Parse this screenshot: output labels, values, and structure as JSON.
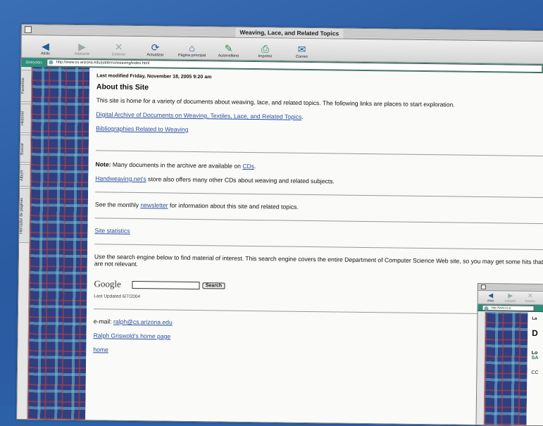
{
  "window": {
    "title": "Weaving, Lace, and Related Topics",
    "toolbar": [
      {
        "label": "Atrás",
        "icon": "back-arrow-icon",
        "enabled": true
      },
      {
        "label": "Adelante",
        "icon": "forward-arrow-icon",
        "enabled": false
      },
      {
        "label": "Detener",
        "icon": "stop-icon",
        "enabled": false
      },
      {
        "label": "Actualizar",
        "icon": "refresh-icon",
        "enabled": true
      },
      {
        "label": "Página principal",
        "icon": "home-icon",
        "enabled": true
      },
      {
        "label": "Autorrelleno",
        "icon": "autofill-icon",
        "enabled": true
      },
      {
        "label": "Imprimir",
        "icon": "print-icon",
        "enabled": true
      },
      {
        "label": "Correo",
        "icon": "mail-icon",
        "enabled": true
      }
    ],
    "address_label": "Dirección:",
    "url": "http://www.cs.arizona.edu/patterns/weaving/index.html",
    "side_tabs": [
      "Favoritos",
      "Historial",
      "Buscar",
      "Álbum",
      "Hervador de páginas"
    ]
  },
  "page": {
    "last_modified": "Last modified Friday, November 18, 2005 9:20 am",
    "heading": "About this Site",
    "intro": "This site is home for a variety of documents about weaving, lace, and related topics. The following links are places to start exploration.",
    "link_archive": "Digital Archive of Documents on Weaving, Textiles, Lace, and Related Topics",
    "link_archive_suffix": ".",
    "link_bibliographies": "Bibliographies Related to Weaving",
    "note_label": "Note:",
    "note_text": " Many documents in the archive are available on ",
    "note_link": "CDs",
    "note_suffix": ".",
    "handweaving_link": "Handweaving.net's",
    "handweaving_text": " store also offers many other CDs about weaving and related subjects.",
    "newsletter_pre": "See the monthly ",
    "newsletter_link": "newsletter",
    "newsletter_post": " for information about this site and related topics.",
    "stats_link": "Site statistics",
    "search_intro": "Use the search engine below to find material of interest. This search engine covers the entire Department of Computer Science Web site, so you may get some hits that are not relevant.",
    "google_logo": "Google",
    "search_button": "Search",
    "last_updated": "Last Updated 6/7/2004",
    "email_label": "e-mail: ",
    "email_link": "ralph@cs.arizona.edu",
    "home_page_link": "Ralph Griswold's home page",
    "home_link": "home"
  },
  "window2": {
    "toolbar": [
      "Atrás",
      "Adelante",
      "Detener"
    ],
    "url": "http://www.cs.ar",
    "lines": [
      "La",
      "D",
      "Lo",
      "SA",
      "CC"
    ]
  }
}
